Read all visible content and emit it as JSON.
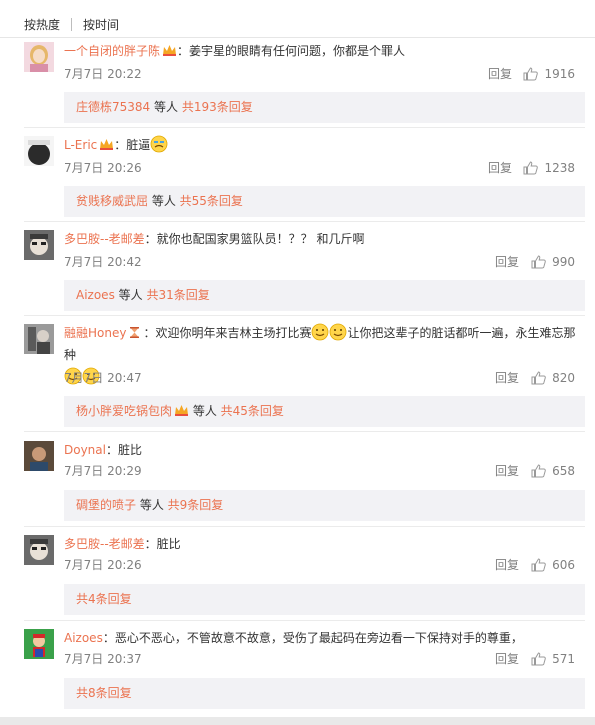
{
  "tabs": {
    "hot": "按热度",
    "time": "按时间"
  },
  "colors": {
    "accent": "#eb7350",
    "meta": "#808080",
    "subbox_bg": "#f2f2f5"
  },
  "icons": {
    "like": "thumbs-up-icon",
    "badge": "vip-crown-icon",
    "emoji": "emoji-face-icon"
  },
  "comments": [
    {
      "user": "一个自闭的胖子陈",
      "text": "：姜宇星的眼睛有任何问题，你都是个罪人",
      "time": "7月7日 20:22",
      "reply": "回复",
      "likes": "1916",
      "sub_user": "庄德栋75384",
      "sub_mid": " 等人 ",
      "sub_count": "共193条回复"
    },
    {
      "user": "L-Eric",
      "text": "：脏逼",
      "time": "7月7日 20:26",
      "reply": "回复",
      "likes": "1238",
      "sub_user": "贫贱移威武屈",
      "sub_mid": " 等人 ",
      "sub_count": "共55条回复"
    },
    {
      "user": "多巴胺--老邮差",
      "text": "：就你也配国家男篮队员！？？ 和几斤啊",
      "time": "7月7日 20:42",
      "reply": "回复",
      "likes": "990",
      "sub_user": "Aizoes",
      "sub_mid": " 等人 ",
      "sub_count": "共31条回复"
    },
    {
      "user": "融融Honey",
      "text_a": "：欢迎你明年来吉林主场打比赛",
      "text_b": "让你把这辈子的脏话都听一遍，永生难忘那种",
      "time": "7月7日 20:47",
      "reply": "回复",
      "likes": "820",
      "sub_user": "杨小胖爱吃锅包肉",
      "sub_mid": " 等人 ",
      "sub_count": "共45条回复"
    },
    {
      "user": "Doynal",
      "text": "：脏比",
      "time": "7月7日 20:29",
      "reply": "回复",
      "likes": "658",
      "sub_user": "碉堡的喷子",
      "sub_mid": " 等人 ",
      "sub_count": "共9条回复"
    },
    {
      "user": "多巴胺--老邮差",
      "text": "：脏比",
      "time": "7月7日 20:26",
      "reply": "回复",
      "likes": "606",
      "sub_count": "共4条回复"
    },
    {
      "user": "Aizoes",
      "text": "：恶心不恶心，不管故意不故意，受伤了最起码在旁边看一下保持对手的尊重，",
      "time": "7月7日 20:37",
      "reply": "回复",
      "likes": "571",
      "sub_count": "共8条回复"
    }
  ]
}
